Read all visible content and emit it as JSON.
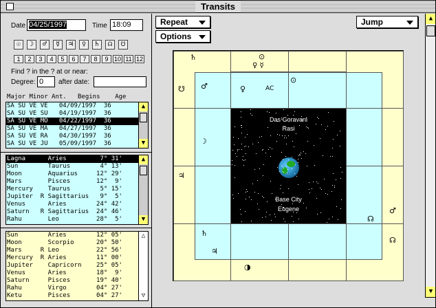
{
  "window": {
    "title": "Transits"
  },
  "form": {
    "date_label": "Date",
    "date_value": "04/25/1997",
    "time_label": "Time",
    "time_value": "18:09",
    "find_text": "Find ? in the ? at or near:",
    "degree_label": "Degree:",
    "degree_value": "0",
    "after_label": "after date:",
    "after_value": ""
  },
  "planet_buttons": [
    "☉",
    "☽",
    "♂",
    "☿",
    "♃",
    "♀",
    "♄",
    "☊",
    "☋"
  ],
  "house_buttons": [
    "1",
    "2",
    "3",
    "4",
    "5",
    "6",
    "7",
    "8",
    "9",
    "10",
    "11",
    "12"
  ],
  "periods": {
    "headers": {
      "major": "Major",
      "minor": "Minor",
      "ant": "Ant.",
      "begins": "Begins",
      "age": "Age"
    },
    "rows": [
      "SA SU VE VE   04/09/1997  36",
      "SA SU VE SU   04/19/1997  36",
      "SA SU VE MO   04/22/1997  36",
      "SA SU VE MA   04/27/1997  36",
      "SA SU VE RA   04/30/1997  36",
      "SA SU VE JU   05/09/1997  36"
    ]
  },
  "natal": {
    "rows": [
      "Lagna      Aries         7° 31'",
      "Sun        Taurus        4° 13'",
      "Moon       Aquarius     12° 29'",
      "Mars       Pisces       12°  9'",
      "Mercury    Taurus        5° 15'",
      "Jupiter  R Sagittarius   9°  5'",
      "Venus      Aries        24° 42'",
      "Saturn   R Sagittarius  24° 46'",
      "Rahu       Leo          28°  5'"
    ]
  },
  "transit": {
    "rows": [
      "Sun        Aries        12° 05'",
      "Moon       Scorpio      20° 50'",
      "Mars     R Leo          22° 56'",
      "Mercury  R Aries        11° 00'",
      "Jupiter    Capricorn    25° 05'",
      "Venus      Aries        18°  9'",
      "Saturn     Pisces       19° 40'",
      "Rahu       Virgo        04° 27'",
      "Ketu       Pisces       04° 27'"
    ]
  },
  "toolbar": {
    "repeat_label": "Repeat",
    "options_label": "Options",
    "jump_label": "Jump"
  },
  "chart_center": {
    "line1": "Das Goravani",
    "line2": "Rasi",
    "line3": "Base City",
    "line4": "Eugene"
  },
  "chart_glyphs": {
    "top1": "♄",
    "top2a": "⊙",
    "top2b": "♀ ☿",
    "r2left": "☋",
    "r2a": "♂",
    "r2b": "♀",
    "r2c": "AC",
    "r2d": "⊙",
    "r3": "☽",
    "r4": "♃",
    "rightA": "♂",
    "rightB": "☋",
    "rightC": "☊",
    "bot1": "♄",
    "bot2": "♃",
    "bot3": "◑"
  },
  "colors": {
    "cyan": "#ccffff",
    "yellow": "#ffffcc",
    "highlight": "#000000"
  }
}
